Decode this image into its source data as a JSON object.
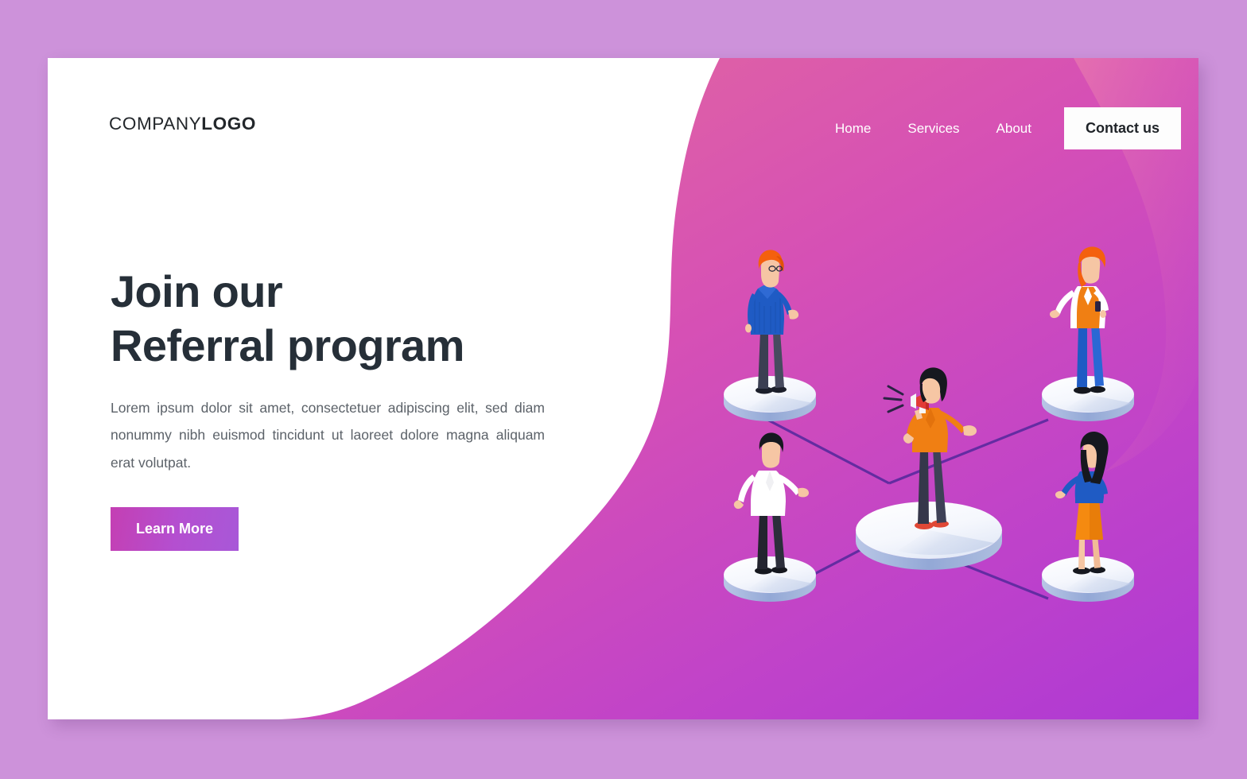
{
  "page": {
    "background_color": "#cd92da",
    "card_background": "#ffffff"
  },
  "header": {
    "logo_light": "COMPANY",
    "logo_bold": "LOGO",
    "nav_items": [
      {
        "label": "Home"
      },
      {
        "label": "Services"
      },
      {
        "label": "About"
      }
    ],
    "contact_button": "Contact us"
  },
  "hero": {
    "title_line1": "Join our",
    "title_line2": "Referral program",
    "paragraph": "Lorem ipsum dolor sit amet, consectetuer adipiscing elit, sed diam nonummy nibh euismod tincidunt ut laoreet dolore magna aliquam erat volutpat.",
    "cta_label": "Learn More",
    "title_color": "#262f38",
    "paragraph_color": "#5c6269",
    "cta_gradient_start": "#c43fb3",
    "cta_gradient_end": "#a858d8"
  },
  "illustration": {
    "name": "referral-network-isometric",
    "description": "Five people standing on white isometric discs connected by purple lines to a central woman with a megaphone",
    "background_gradient_start": "#e2689f",
    "background_gradient_end": "#b23ad2",
    "connector_color": "#5b2a9e",
    "disc_top_color": "#ffffff",
    "disc_rim_color": "#9fb2dd",
    "nodes": [
      {
        "position": "top-left",
        "name": "person-orange-hair-blue-sweater",
        "hair": "#f4600e",
        "top": "#1f5bc4",
        "bottom": "#3b3f52",
        "shoes": "#1c1f2b"
      },
      {
        "position": "bottom-left",
        "name": "person-black-hair-white-shirt",
        "hair": "#16181f",
        "top": "#ffffff",
        "bottom": "#23242f",
        "shoes": "#16181f"
      },
      {
        "position": "center",
        "name": "person-megaphone-speaker",
        "hair": "#16181f",
        "top": "#f07f13",
        "bottom": "#35374a",
        "shoes": "#e04836",
        "prop": "megaphone",
        "prop_color": "#e23b36"
      },
      {
        "position": "top-right",
        "name": "person-orange-hair-phone",
        "hair": "#f4600e",
        "top": "#f07f13",
        "bottom": "#1f5bc4",
        "shoes": "#16181f"
      },
      {
        "position": "bottom-right",
        "name": "person-black-hair-orange-skirt",
        "hair": "#16181f",
        "top": "#1f5bc4",
        "bottom": "#f58a10",
        "shoes": "#16181f"
      }
    ]
  }
}
